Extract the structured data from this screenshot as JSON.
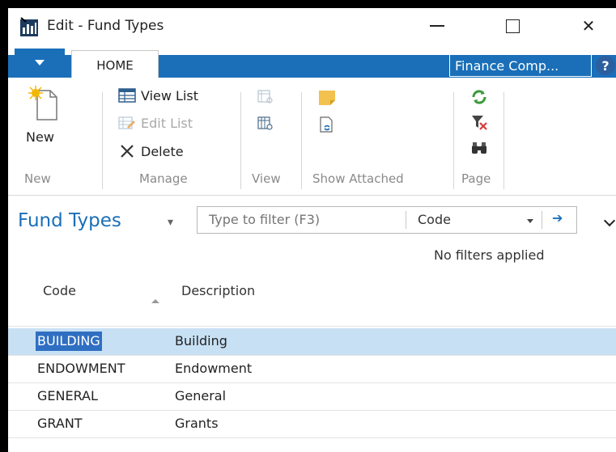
{
  "window": {
    "title": "Edit - Fund Types",
    "minimize_icon": "minimize-icon",
    "maximize_icon": "maximize-icon",
    "close_icon": "close-icon",
    "close_glyph": "✕"
  },
  "ribbon_tabs": {
    "home_label": "HOME",
    "company_label": "Finance Comp...",
    "help_glyph": "?"
  },
  "ribbon": {
    "new": {
      "label": "New",
      "group": "New"
    },
    "manage": {
      "group": "Manage",
      "view_list": "View List",
      "edit_list": "Edit List",
      "delete": "Delete"
    },
    "view": {
      "group": "View"
    },
    "show_attached": {
      "group": "Show Attached"
    },
    "page": {
      "group": "Page"
    }
  },
  "list": {
    "title": "Fund Types",
    "filter_placeholder": "Type to filter (F3)",
    "filter_field": "Code",
    "filter_status": "No filters applied",
    "columns": {
      "code": "Code",
      "description": "Description"
    },
    "rows": [
      {
        "code": "BUILDING",
        "description": "Building",
        "selected": true
      },
      {
        "code": "ENDOWMENT",
        "description": "Endowment",
        "selected": false
      },
      {
        "code": "GENERAL",
        "description": "General",
        "selected": false
      },
      {
        "code": "GRANT",
        "description": "Grants",
        "selected": false
      }
    ]
  },
  "colors": {
    "accent": "#1a6fb8",
    "selection_row": "#c7e0f4",
    "selection_cell": "#2f6fc2"
  }
}
